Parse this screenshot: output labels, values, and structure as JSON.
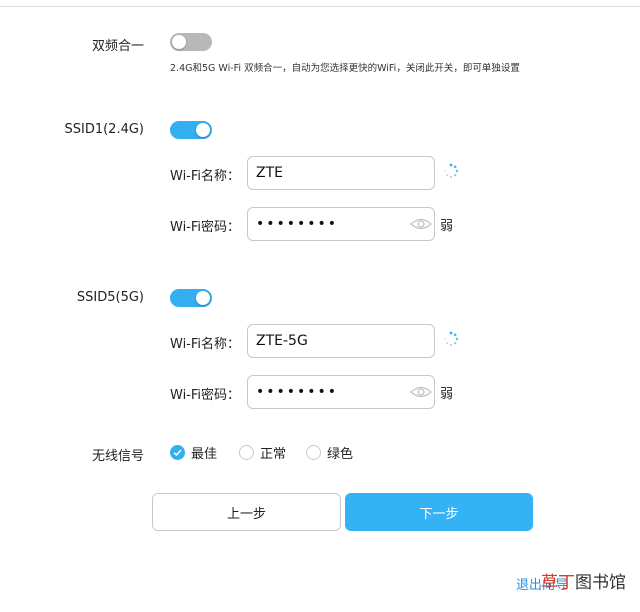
{
  "dual_band": {
    "label": "双频合一",
    "enabled": false,
    "hint": "2.4G和5G Wi-Fi 双频合一，自动为您选择更快的WiFi，关闭此开关，即可单独设置"
  },
  "ssid1": {
    "label": "SSID1(2.4G)",
    "enabled": true,
    "name_label": "Wi-Fi名称：",
    "name_value": "ZTE",
    "password_label": "Wi-Fi密码：",
    "password_value": "••••••••",
    "strength": "弱"
  },
  "ssid5": {
    "label": "SSID5(5G)",
    "enabled": true,
    "name_label": "Wi-Fi名称：",
    "name_value": "ZTE-5G",
    "password_label": "Wi-Fi密码：",
    "password_value": "••••••••",
    "strength": "弱"
  },
  "signal": {
    "label": "无线信号",
    "options": [
      {
        "label": "最佳",
        "checked": true
      },
      {
        "label": "正常",
        "checked": false
      },
      {
        "label": "绿色",
        "checked": false
      }
    ]
  },
  "buttons": {
    "prev": "上一步",
    "next": "下一步"
  },
  "footer": {
    "exit": "退出向导",
    "watermark_red": "草丁",
    "watermark_dark": "图书馆"
  },
  "colors": {
    "accent": "#33aef0",
    "toggle_off": "#b8b8b8"
  }
}
